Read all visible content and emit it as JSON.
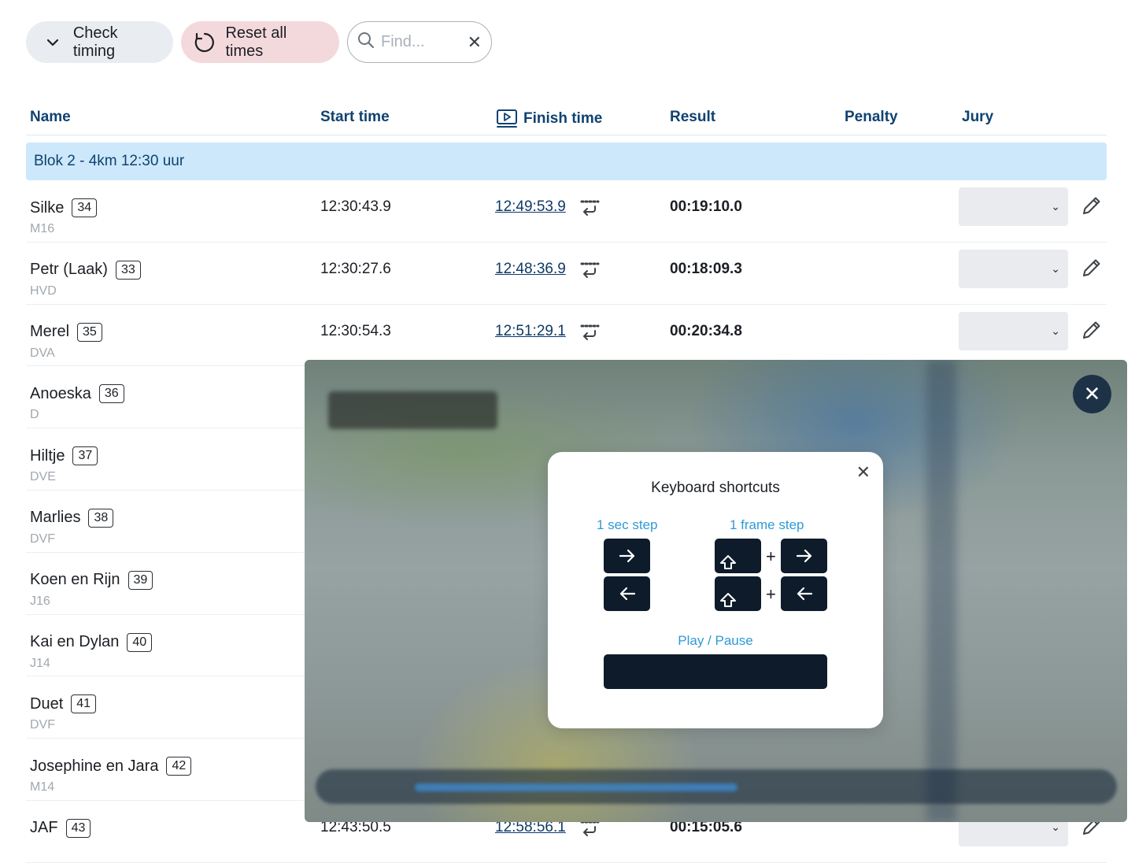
{
  "toolbar": {
    "check_timing_label": "Check timing",
    "reset_label": "Reset all times",
    "search_placeholder": "Find..."
  },
  "table": {
    "headers": {
      "name": "Name",
      "start": "Start time",
      "finish": "Finish time",
      "result": "Result",
      "penalty": "Penalty",
      "jury": "Jury"
    },
    "group_label": "Blok 2 - 4km 12:30 uur",
    "rows": [
      {
        "name": "Silke",
        "bib": "34",
        "club": "M16",
        "start": "12:30:43.9",
        "finish": "12:49:53.9",
        "result": "00:19:10.0"
      },
      {
        "name": "Petr (Laak)",
        "bib": "33",
        "club": "HVD",
        "start": "12:30:27.6",
        "finish": "12:48:36.9",
        "result": "00:18:09.3"
      },
      {
        "name": "Merel",
        "bib": "35",
        "club": "DVA",
        "start": "12:30:54.3",
        "finish": "12:51:29.1",
        "result": "00:20:34.8"
      },
      {
        "name": "Anoeska",
        "bib": "36",
        "club": "D"
      },
      {
        "name": "Hiltje",
        "bib": "37",
        "club": "DVE"
      },
      {
        "name": "Marlies",
        "bib": "38",
        "club": "DVF"
      },
      {
        "name": "Koen en Rijn",
        "bib": "39",
        "club": "J16"
      },
      {
        "name": "Kai en Dylan",
        "bib": "40",
        "club": "J14"
      },
      {
        "name": "Duet",
        "bib": "41",
        "club": "DVF"
      },
      {
        "name": "Josephine en Jara",
        "bib": "42",
        "club": "M14"
      },
      {
        "name": "JAF",
        "bib": "43",
        "club": "",
        "start": "12:43:50.5",
        "finish": "12:58:56.1",
        "result": "00:15:05.6"
      }
    ]
  },
  "modal": {
    "title": "Keyboard shortcuts",
    "sec_step_label": "1 sec step",
    "frame_step_label": "1 frame step",
    "plus": "+",
    "play_pause_label": "Play / Pause"
  },
  "icons": {
    "check": "chevron-down-icon",
    "reset": "refresh-icon",
    "search": "search-icon",
    "clear": "close-icon",
    "video": "video-play-icon",
    "swap": "swap-icon",
    "edit": "pencil-icon"
  },
  "colors": {
    "header_text": "#0f4270",
    "group_bg": "#cde8fb",
    "reset_bg": "#f4d9dc",
    "check_bg": "#e9edf1",
    "shortcut_label": "#2f9ad6",
    "key_bg": "#0d1b2a"
  }
}
